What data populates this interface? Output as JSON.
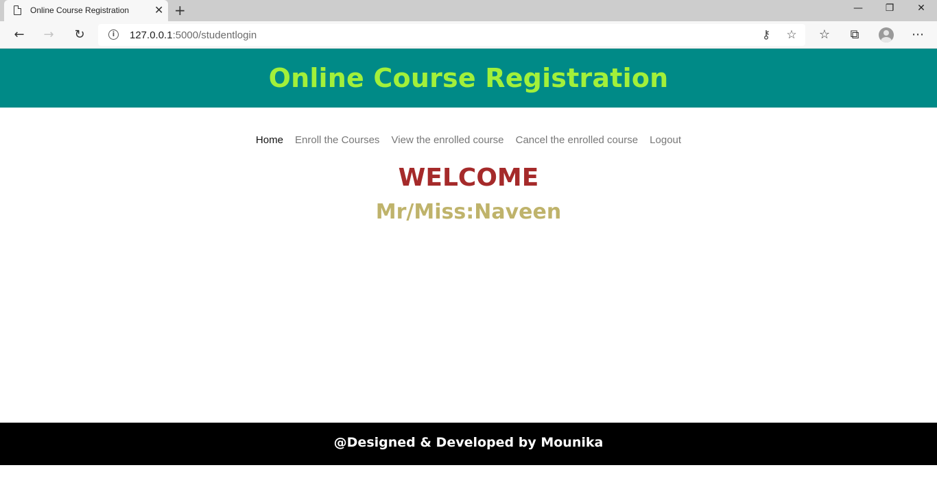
{
  "browser": {
    "tab_title": "Online Course Registration",
    "tab_close_glyph": "✕",
    "new_tab_glyph": "+",
    "window_controls": {
      "minimize": "—",
      "restore": "❐",
      "close": "✕"
    },
    "address": {
      "host": "127.0.0.1",
      "rest": ":5000/studentlogin"
    },
    "icons": [
      "back-arrow-icon",
      "forward-arrow-icon",
      "refresh-icon",
      "info-icon",
      "key-icon",
      "star-icon",
      "favorites-icon",
      "collections-icon",
      "profile-icon",
      "more-icon"
    ]
  },
  "header": {
    "title": "Online Course Registration"
  },
  "nav": {
    "items": [
      {
        "label": "Home",
        "active": true
      },
      {
        "label": "Enroll the Courses",
        "active": false
      },
      {
        "label": "View the enrolled course",
        "active": false
      },
      {
        "label": "Cancel the enrolled course",
        "active": false
      },
      {
        "label": "Logout",
        "active": false
      }
    ]
  },
  "main": {
    "welcome": "WELCOME",
    "greeting": "Mr/Miss:Naveen"
  },
  "footer": {
    "text": "@Designed & Developed by Mounika"
  },
  "colors": {
    "header_bg": "#008a87",
    "title": "#a2f03a",
    "welcome": "#a52a2a",
    "greeting": "#bfb36b",
    "footer_bg": "#000000"
  }
}
